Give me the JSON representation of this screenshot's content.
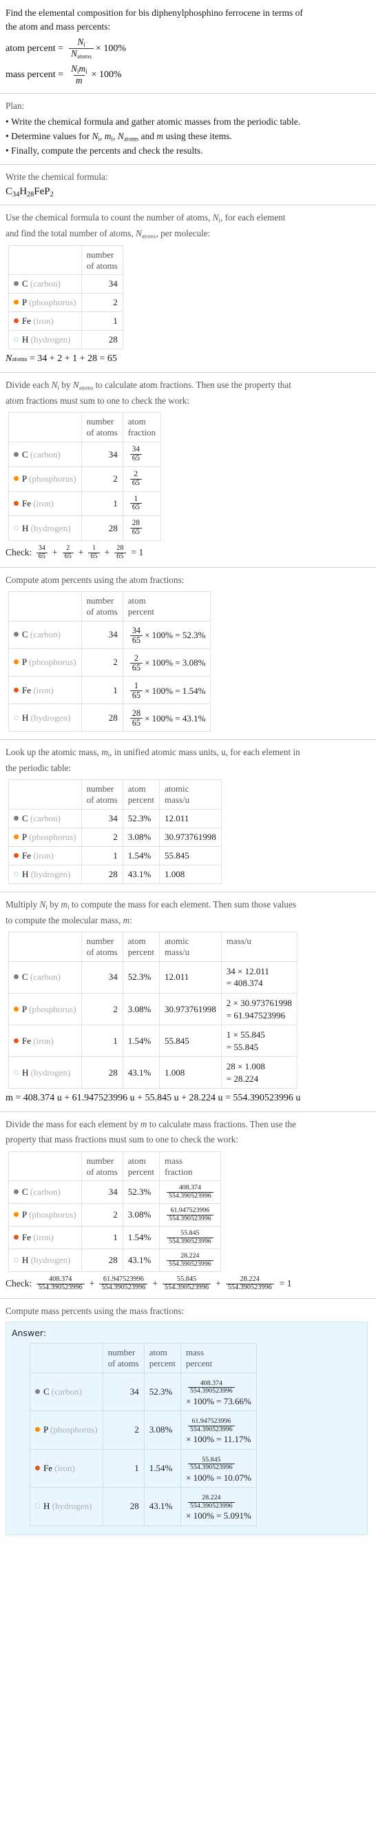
{
  "question": {
    "line1": "Find the elemental composition for bis diphenylphosphino ferrocene in terms of",
    "line2": "the atom and mass percents:",
    "atom_percent_label": "atom percent =",
    "atom_percent_num": "N",
    "atom_percent_num_sub": "i",
    "atom_percent_den": "N",
    "atom_percent_den_sub": "atoms",
    "atom_percent_tail": "× 100%",
    "mass_percent_label": "mass percent =",
    "mass_percent_num": "N",
    "mass_percent_num_sub": "i",
    "mass_percent_num2": "m",
    "mass_percent_num2_sub": "i",
    "mass_percent_den": "m",
    "mass_percent_tail": "× 100%"
  },
  "plan": {
    "heading": "Plan:",
    "items": [
      "Write the chemical formula and gather atomic masses from the periodic table.",
      "Determine values for Ni, mi, Natoms and m using these items.",
      "Finally, compute the percents and check the results."
    ],
    "item2_parts": {
      "pre": "Determine values for ",
      "mid": " and ",
      "post": " using these items."
    }
  },
  "formula_section": {
    "prompt": "Write the chemical formula:",
    "formula_display": "C34H28FeP2",
    "formula_parts": [
      {
        "sym": "C",
        "sub": "34"
      },
      {
        "sym": "H",
        "sub": "28"
      },
      {
        "sym": "Fe",
        "sub": ""
      },
      {
        "sym": "P",
        "sub": "2"
      }
    ]
  },
  "colors": {
    "carbon": "#808080",
    "phosphorus": "#ff8c00",
    "iron": "#e2571e",
    "hydrogen": "#ffffff",
    "hydrogen_border": "#b9d9e8",
    "answer_bg": "#eaf6fd",
    "answer_border": "#cfe6f2",
    "rule": "#cfcfcf"
  },
  "elements": [
    {
      "symbol": "C",
      "name": "(carbon)",
      "dot": "carbon"
    },
    {
      "symbol": "P",
      "name": "(phosphorus)",
      "dot": "phosphorus"
    },
    {
      "symbol": "Fe",
      "name": "(iron)",
      "dot": "iron"
    },
    {
      "symbol": "H",
      "name": "(hydrogen)",
      "dot": "hydrogen"
    }
  ],
  "headers": {
    "number_of_atoms_l1": "number",
    "number_of_atoms_l2": "of atoms",
    "atom_fraction_l1": "atom",
    "atom_fraction_l2": "fraction",
    "atom_percent_l1": "atom",
    "atom_percent_l2": "percent",
    "atomic_mass_l1": "atomic",
    "atomic_mass_l2": "mass/u",
    "mass_l1": "mass/u",
    "mass_fraction_l1": "mass",
    "mass_fraction_l2": "fraction",
    "mass_percent_l1": "mass",
    "mass_percent_l2": "percent"
  },
  "count_section": {
    "prompt_l1": "Use the chemical formula to count the number of atoms, Ni, for each element",
    "prompt_l2": "and find the total number of atoms, Natoms, per molecule:",
    "counts": [
      "34",
      "2",
      "1",
      "28"
    ],
    "total_line": "Natoms = 34 + 2 + 1 + 28 = 65",
    "total_expr": "= 34 + 2 + 1 + 28 = 65"
  },
  "fraction_section": {
    "prompt_l1": "Divide each Ni by Natoms to calculate atom fractions. Then use the property that",
    "prompt_l2": "atom fractions must sum to one to check the work:",
    "denominator": "65",
    "numerators": [
      "34",
      "2",
      "1",
      "28"
    ],
    "check_label": "Check:",
    "check_terms": [
      "34",
      "2",
      "1",
      "28"
    ],
    "check_result": "= 1"
  },
  "atom_percent_section": {
    "prompt": "Compute atom percents using the atom fractions:",
    "denominator": "65",
    "numerators": [
      "34",
      "2",
      "1",
      "28"
    ],
    "results": [
      "× 100% = 52.3%",
      "× 100% = 3.08%",
      "× 100% = 1.54%",
      "× 100% = 43.1%"
    ],
    "percents": [
      "52.3%",
      "3.08%",
      "1.54%",
      "43.1%"
    ]
  },
  "atomic_mass_section": {
    "prompt_l1": "Look up the atomic mass, mi, in unified atomic mass units, u, for each element in",
    "prompt_l2": "the periodic table:",
    "atom_percents": [
      "52.3%",
      "3.08%",
      "1.54%",
      "43.1%"
    ],
    "atomic_masses": [
      "12.011",
      "30.973761998",
      "55.845",
      "1.008"
    ]
  },
  "mass_section": {
    "prompt_l1": "Multiply Ni by mi to compute the mass for each element. Then sum those values",
    "prompt_l2": "to compute the molecular mass, m:",
    "mass_exprs_l1": [
      "34 × 12.011",
      "2 × 30.973761998",
      "1 × 55.845",
      "28 × 1.008"
    ],
    "mass_exprs_l2": [
      "= 408.374",
      "= 61.947523996",
      "= 55.845",
      "= 28.224"
    ],
    "molecular_mass_line": "m = 408.374 u + 61.947523996 u + 55.845 u + 28.224 u = 554.390523996 u"
  },
  "mass_fraction_section": {
    "prompt_l1": "Divide the mass for each element by m to calculate mass fractions. Then use the",
    "prompt_l2": "property that mass fractions must sum to one to check the work:",
    "denominator": "554.390523996",
    "numerators": [
      "408.374",
      "61.947523996",
      "55.845",
      "28.224"
    ],
    "check_label": "Check:",
    "check_result": "= 1"
  },
  "mass_percent_section": {
    "prompt": "Compute mass percents using the mass fractions:",
    "answer_label": "Answer:",
    "denominator": "554.390523996",
    "numerators": [
      "408.374",
      "61.947523996",
      "55.845",
      "28.224"
    ],
    "results": [
      "× 100% = 73.66%",
      "× 100% = 11.17%",
      "× 100% = 10.07%",
      "× 100% = 5.091%"
    ],
    "counts": [
      "34",
      "2",
      "1",
      "28"
    ],
    "atom_percents": [
      "52.3%",
      "3.08%",
      "1.54%",
      "43.1%"
    ]
  },
  "chart_data": {
    "type": "table",
    "title": "Elemental composition of bis diphenylphosphino ferrocene (C34H28FeP2)",
    "categories": [
      "C (carbon)",
      "P (phosphorus)",
      "Fe (iron)",
      "H (hydrogen)"
    ],
    "series": [
      {
        "name": "number of atoms",
        "values": [
          34,
          2,
          1,
          28
        ]
      },
      {
        "name": "atom percent",
        "values": [
          52.3,
          3.08,
          1.54,
          43.1
        ]
      },
      {
        "name": "atomic mass/u",
        "values": [
          12.011,
          30.973761998,
          55.845,
          1.008
        ]
      },
      {
        "name": "mass/u",
        "values": [
          408.374,
          61.947523996,
          55.845,
          28.224
        ]
      },
      {
        "name": "mass percent",
        "values": [
          73.66,
          11.17,
          10.07,
          5.091
        ]
      }
    ],
    "total_atoms": 65,
    "molecular_mass": 554.390523996
  }
}
